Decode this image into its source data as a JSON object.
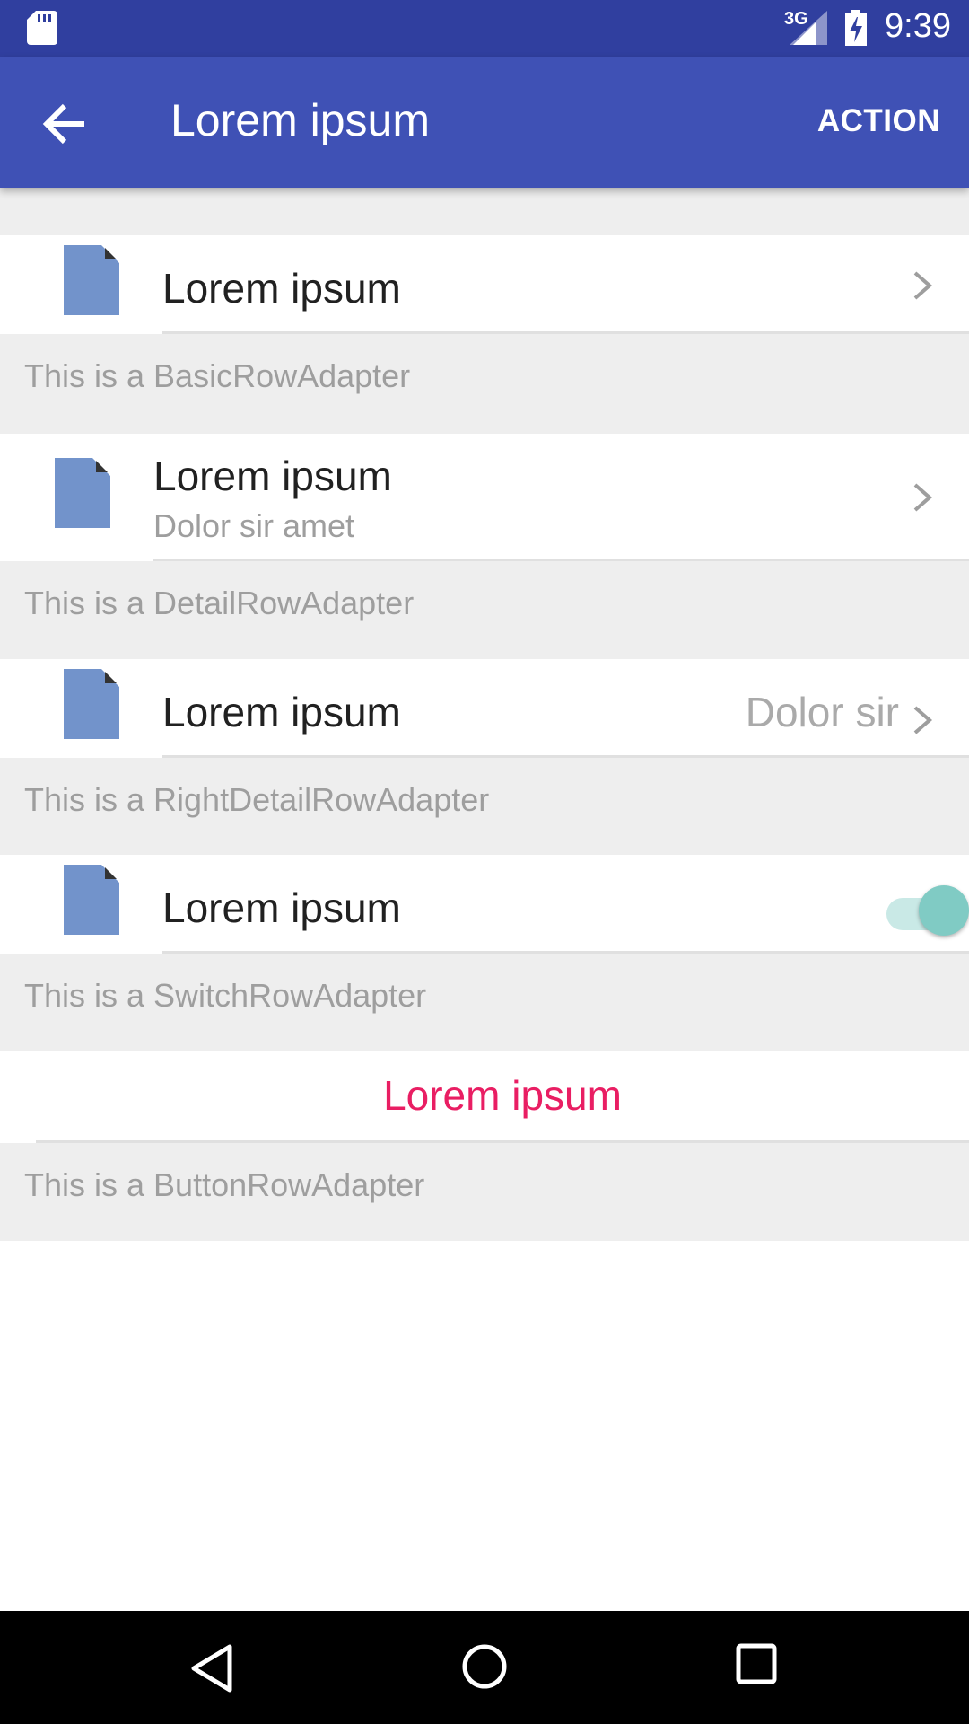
{
  "status_bar": {
    "network": "3G",
    "time": "9:39",
    "icons": [
      "sd-card-icon",
      "signal-icon",
      "battery-charging-icon"
    ]
  },
  "app_bar": {
    "title": "Lorem ipsum",
    "action_label": "ACTION",
    "back_icon": "arrow-back-icon"
  },
  "colors": {
    "primary": "#3F51B5",
    "primary_dark": "#303F9F",
    "accent": "#E91E63",
    "switch_on": "#80CBC4",
    "doc_icon": "#7293CB",
    "section_bg": "#EEEEEE"
  },
  "rows": {
    "basic": {
      "title": "Lorem ipsum",
      "footer": "This is a BasicRowAdapter"
    },
    "detail": {
      "title": "Lorem ipsum",
      "subtitle": "Dolor sir amet",
      "footer": "This is a DetailRowAdapter"
    },
    "right_detail": {
      "title": "Lorem ipsum",
      "detail": "Dolor sir",
      "footer": "This is a RightDetailRowAdapter"
    },
    "switch": {
      "title": "Lorem ipsum",
      "checked": true,
      "footer": "This is a SwitchRowAdapter"
    },
    "button": {
      "label": "Lorem ipsum",
      "footer": "This is a ButtonRowAdapter"
    }
  }
}
